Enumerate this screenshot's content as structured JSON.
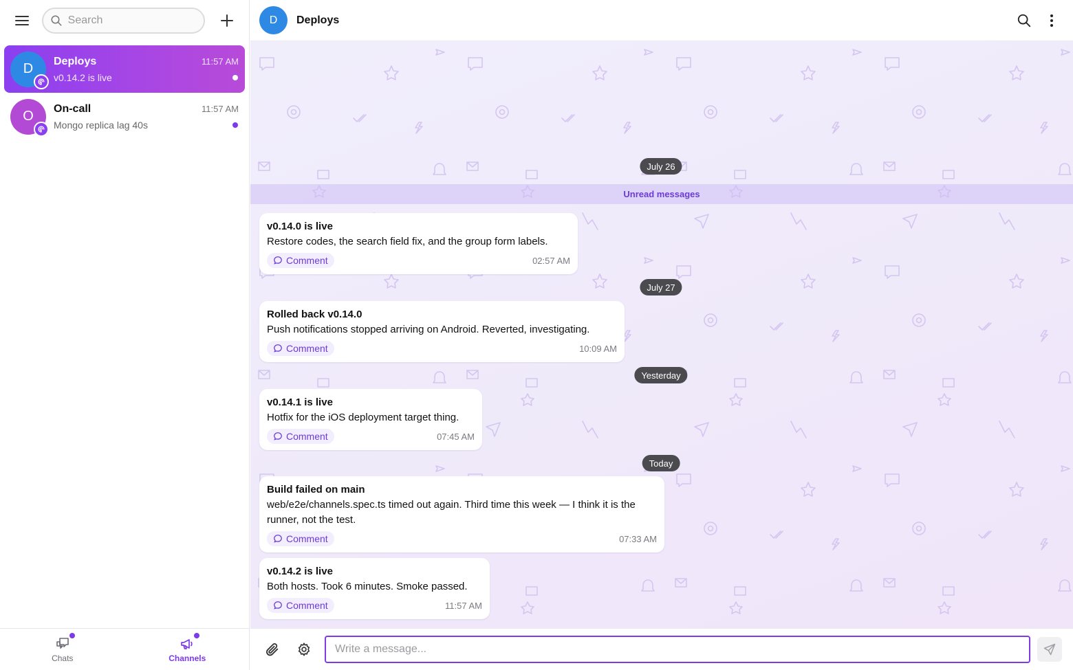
{
  "sidebar": {
    "search_placeholder": "Search",
    "chats": [
      {
        "name": "Deploys",
        "initial": "D",
        "time": "11:57 AM",
        "preview": "v0.14.2 is live",
        "avatar_color": "#2e89e4",
        "active": true
      },
      {
        "name": "On-call",
        "initial": "O",
        "time": "11:57 AM",
        "preview": "Mongo replica lag 40s",
        "avatar_color": "#b24ad6",
        "active": false
      }
    ],
    "nav": {
      "chats_label": "Chats",
      "channels_label": "Channels"
    }
  },
  "header": {
    "title": "Deploys",
    "initial": "D"
  },
  "conversation": {
    "unread_label": "Unread messages",
    "dates": [
      "July 26",
      "July 27",
      "Yesterday",
      "Today"
    ],
    "comment_label": "Comment",
    "messages": [
      {
        "title": "v0.14.0 is live",
        "body": "Restore codes, the search field fix, and the group form labels.",
        "time": "02:57 AM"
      },
      {
        "title": "Rolled back v0.14.0",
        "body": "Push notifications stopped arriving on Android. Reverted, investigating.",
        "time": "10:09 AM"
      },
      {
        "title": "v0.14.1 is live",
        "body": "Hotfix for the iOS deployment target thing.",
        "time": "07:45 AM"
      },
      {
        "title": "Build failed on main",
        "body": "web/e2e/channels.spec.ts timed out again. Third time this week — I think it is the runner, not the test.",
        "time": "07:33 AM"
      },
      {
        "title": "v0.14.2 is live",
        "body": "Both hosts. Took 6 minutes. Smoke passed.",
        "time": "11:57 AM"
      }
    ]
  },
  "composer": {
    "placeholder": "Write a message..."
  },
  "colors": {
    "accent": "#7d3ae8",
    "active_gradient_start": "#8b3ff0",
    "active_gradient_end": "#b84bd8"
  }
}
